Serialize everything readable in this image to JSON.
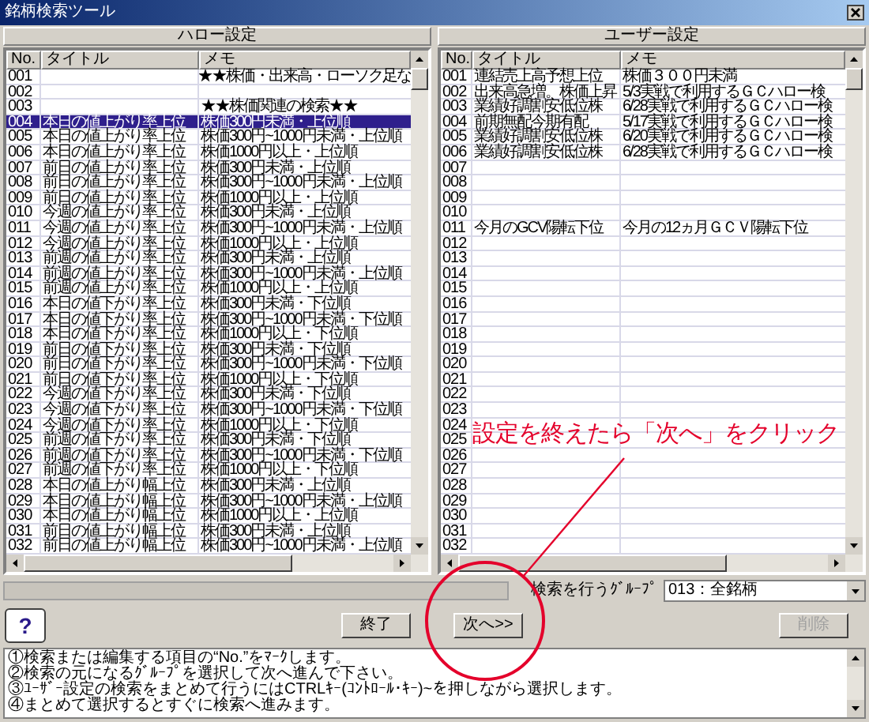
{
  "window": {
    "title": "銘柄検索ツール"
  },
  "hello_panel": {
    "title": "ハロー設定",
    "columns": [
      "No.",
      "タイトル",
      "メモ"
    ],
    "rows": [
      {
        "no": "001",
        "memo": "★★株価・出来高・ローソク足な",
        "selected": false
      },
      {
        "no": "002",
        "selected": false
      },
      {
        "no": "003",
        "memo": "★★株価関連の検索★★",
        "selected": false
      },
      {
        "no": "004",
        "title": "本日の値上がり率上位",
        "memo": "株価300円未満・上位順",
        "selected": true
      },
      {
        "no": "005",
        "title": "本日の値上がり率上位",
        "memo": "株価300円~1000円未満・上位順",
        "selected": false
      },
      {
        "no": "006",
        "title": "本日の値上がり率上位",
        "memo": "株価1000円以上・上位順",
        "selected": false
      },
      {
        "no": "007",
        "title": "前日の値上がり率上位",
        "memo": "株価300円未満・上位順",
        "selected": false
      },
      {
        "no": "008",
        "title": "前日の値上がり率上位",
        "memo": "株価300円~1000円未満・上位順",
        "selected": false
      },
      {
        "no": "009",
        "title": "前日の値上がり率上位",
        "memo": "株価1000円以上・上位順",
        "selected": false
      },
      {
        "no": "010",
        "title": "今週の値上がり率上位",
        "memo": "株価300円未満・上位順",
        "selected": false
      },
      {
        "no": "011",
        "title": "今週の値上がり率上位",
        "memo": "株価300円~1000円未満・上位順",
        "selected": false
      },
      {
        "no": "012",
        "title": "今週の値上がり率上位",
        "memo": "株価1000円以上・上位順",
        "selected": false
      },
      {
        "no": "013",
        "title": "前週の値上がり率上位",
        "memo": "株価300円未満・上位順",
        "selected": false
      },
      {
        "no": "014",
        "title": "前週の値上がり率上位",
        "memo": "株価300円~1000円未満・上位順",
        "selected": false
      },
      {
        "no": "015",
        "title": "前週の値上がり率上位",
        "memo": "株価1000円以上・上位順",
        "selected": false
      },
      {
        "no": "016",
        "title": "本日の値下がり率上位",
        "memo": "株価300円未満・下位順",
        "selected": false
      },
      {
        "no": "017",
        "title": "本日の値下がり率上位",
        "memo": "株価300円~1000円未満・下位順",
        "selected": false
      },
      {
        "no": "018",
        "title": "本日の値下がり率上位",
        "memo": "株価1000円以上・下位順",
        "selected": false
      },
      {
        "no": "019",
        "title": "前日の値下がり率上位",
        "memo": "株価300円未満・下位順",
        "selected": false
      },
      {
        "no": "020",
        "title": "前日の値下がり率上位",
        "memo": "株価300円~1000円未満・下位順",
        "selected": false
      },
      {
        "no": "021",
        "title": "前日の値下がり率上位",
        "memo": "株価1000円以上・下位順",
        "selected": false
      },
      {
        "no": "022",
        "title": "今週の値下がり率上位",
        "memo": "株価300円未満・下位順",
        "selected": false
      },
      {
        "no": "023",
        "title": "今週の値下がり率上位",
        "memo": "株価300円~1000円未満・下位順",
        "selected": false
      },
      {
        "no": "024",
        "title": "今週の値下がり率上位",
        "memo": "株価1000円以上・下位順",
        "selected": false
      },
      {
        "no": "025",
        "title": "前週の値下がり率上位",
        "memo": "株価300円未満・下位順",
        "selected": false
      },
      {
        "no": "026",
        "title": "前週の値下がり率上位",
        "memo": "株価300円~1000円未満・下位順",
        "selected": false
      },
      {
        "no": "027",
        "title": "前週の値下がり率上位",
        "memo": "株価1000円以上・下位順",
        "selected": false
      },
      {
        "no": "028",
        "title": "本日の値上がり幅上位",
        "memo": "株価300円未満・上位順",
        "selected": false
      },
      {
        "no": "029",
        "title": "本日の値上がり幅上位",
        "memo": "株価300円~1000円未満・上位順",
        "selected": false
      },
      {
        "no": "030",
        "title": "本日の値上がり幅上位",
        "memo": "株価1000円以上・上位順",
        "selected": false
      },
      {
        "no": "031",
        "title": "前日の値上がり幅上位",
        "memo": "株価300円未満・上位順",
        "selected": false
      },
      {
        "no": "032",
        "title": "前日の値上がり幅上位",
        "memo": "株価300円~1000円未満・上位順",
        "selected": false
      }
    ]
  },
  "user_panel": {
    "title": "ユーザー設定",
    "columns": [
      "No.",
      "タイトル",
      "メモ"
    ],
    "rows": [
      {
        "no": "001",
        "title": "連結売上高予想上位",
        "memo": "株価３００円未満",
        "selected": false
      },
      {
        "no": "002",
        "title": "出来高急増。株価上昇",
        "memo": "5/3実戦で利用するＧＣハロー検",
        "selected": false
      },
      {
        "no": "003",
        "title": "業績好調割安低位株",
        "memo": "6/28実戦で利用するＧＣハロー検",
        "selected": false
      },
      {
        "no": "004",
        "title": "前期無配今期有配",
        "memo": "5/17実戦で利用するＧＣハロー検",
        "selected": false
      },
      {
        "no": "005",
        "title": "業績好調割安低位株",
        "memo": "6/20実戦で利用するＧＣハロー検",
        "selected": false
      },
      {
        "no": "006",
        "title": "業績好調割安低位株",
        "memo": "6/28実戦で利用するＧＣハロー検",
        "selected": false
      },
      {
        "no": "007",
        "selected": false
      },
      {
        "no": "008",
        "selected": false
      },
      {
        "no": "009",
        "selected": false
      },
      {
        "no": "010",
        "selected": false
      },
      {
        "no": "011",
        "title": "今月のGCV陽転下位",
        "memo": "今月の12ヵ月ＧＣＶ陽転下位",
        "selected": false
      },
      {
        "no": "012",
        "selected": false
      },
      {
        "no": "013",
        "selected": false
      },
      {
        "no": "014",
        "selected": false
      },
      {
        "no": "015",
        "selected": false
      },
      {
        "no": "016",
        "selected": false
      },
      {
        "no": "017",
        "selected": false
      },
      {
        "no": "018",
        "selected": false
      },
      {
        "no": "019",
        "selected": false
      },
      {
        "no": "020",
        "selected": false
      },
      {
        "no": "021",
        "selected": false
      },
      {
        "no": "022",
        "selected": false
      },
      {
        "no": "023",
        "selected": false
      },
      {
        "no": "024",
        "selected": false
      },
      {
        "no": "025",
        "selected": false
      },
      {
        "no": "026",
        "selected": false
      },
      {
        "no": "027",
        "selected": false
      },
      {
        "no": "028",
        "selected": false
      },
      {
        "no": "029",
        "selected": false
      },
      {
        "no": "030",
        "selected": false
      },
      {
        "no": "031",
        "selected": false
      },
      {
        "no": "032",
        "selected": false
      }
    ]
  },
  "group": {
    "label": "検索を行うｸﾞﾙｰﾌﾟ",
    "value": "013：全銘柄"
  },
  "help_button": "?",
  "buttons": [
    {
      "label": "終了",
      "disabled": false
    },
    {
      "label": "次へ>>",
      "disabled": false
    },
    {
      "label": "削除",
      "disabled": true
    }
  ],
  "instructions": [
    "①検索または編集する項目の“No.”をﾏｰｸします。",
    "②検索の元になるｸﾞﾙｰﾌﾟを選択して次へ進んで下さい。",
    "③ﾕｰｻﾞｰ設定の検索をまとめて行うにはCTRLｷｰ(ｺﾝﾄﾛｰﾙ･ｷｰ)~を押しながら選択します。",
    "④まとめて選択するとすぐに検索へ進みます。"
  ],
  "annotation": {
    "text": "設定を終えたら「次へ」をクリック"
  }
}
